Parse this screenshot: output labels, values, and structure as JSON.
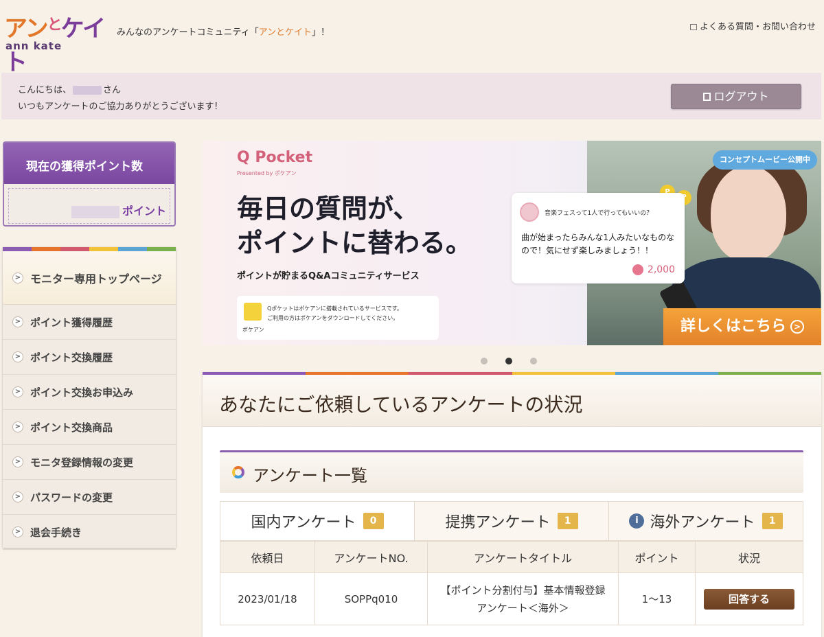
{
  "header": {
    "logo_line1_a": "アン",
    "logo_line1_to": "と",
    "logo_line1_b": "ケイト",
    "logo_line2": "ann   kate",
    "tagline_prefix": "みんなのアンケートコミュニティ「",
    "tagline_brand": "アンとケイト",
    "tagline_suffix": "」！",
    "faq_link": "よくある質問・お問い合わせ"
  },
  "greeting": {
    "hello_prefix": "こんにちは、",
    "hello_suffix": "さん",
    "thanks": "いつもアンケートのご協力ありがとうございます！",
    "logout_label": "ログアウト"
  },
  "points_box": {
    "title": "現在の獲得ポイント数",
    "unit": "ポイント"
  },
  "sidebar": {
    "stripe_colors": [
      "#8c5bb3",
      "#e6742c",
      "#d25a6e",
      "#f2c23a",
      "#5ba5d6",
      "#7bb04a"
    ],
    "items": [
      {
        "label": "モニター専用トップページ"
      },
      {
        "label": "ポイント獲得履歴"
      },
      {
        "label": "ポイント交換履歴"
      },
      {
        "label": "ポイント交換お申込み"
      },
      {
        "label": "ポイント交換商品"
      },
      {
        "label": "モニタ登録情報の変更"
      },
      {
        "label": "パスワードの変更"
      },
      {
        "label": "退会手続き"
      }
    ]
  },
  "banner": {
    "brand": "Q Pocket",
    "presented": "Presented by ポケアン",
    "headline1": "毎日の質問が、",
    "headline2": "ポイントに替わる。",
    "subhead": "ポイントが貯まるQ&Aコミュニティサービス",
    "note_line1": "Qポケットはポケアンに搭載されているサービスです。",
    "note_line2": "ご利用の方はポケアンをダウンロードしてください。",
    "note_brand": "ポケアン",
    "card_question": "音楽フェスって1人で行ってもいいの？",
    "card_answer": "曲が始まったらみんな1人みたいなものなので！気にせず楽しみましょう！！",
    "card_points": "2,000",
    "coin_label": "P",
    "badge": "コンセプトムービー公開中",
    "cta": "詳しくはこちら",
    "cta_icon": ">"
  },
  "carousel": {
    "active_index": 1,
    "count": 3
  },
  "main": {
    "title": "あなたにご依頼しているアンケートの状況",
    "list_title": "アンケート一覧",
    "tabs": [
      {
        "label": "国内アンケート",
        "count": "0"
      },
      {
        "label": "提携アンケート",
        "count": "1"
      },
      {
        "label": "海外アンケート",
        "count": "1",
        "info": "i"
      }
    ],
    "columns": [
      "依頼日",
      "アンケートNO.",
      "アンケートタイトル",
      "ポイント",
      "状況"
    ],
    "rows": [
      {
        "date": "2023/01/18",
        "no": "SOPPq010",
        "title_line1": "【ポイント分割付与】基本情報登録",
        "title_line2": "アンケート＜海外＞",
        "points": "1～13",
        "action": "回答する"
      }
    ]
  },
  "colors": {
    "accent_purple": "#8a5fae",
    "logout_bg": "#9b8a96",
    "cta_orange": "#e3822a",
    "answer_brown": "#6b3f22"
  }
}
